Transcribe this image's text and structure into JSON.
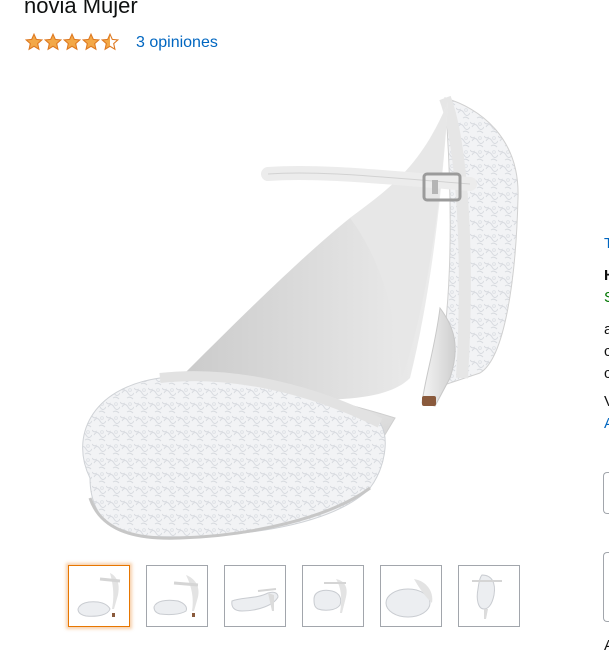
{
  "product": {
    "title": "novia Mujer",
    "rating": 4.5,
    "rating_max": 5,
    "reviews_text": "3 opiniones",
    "star_color": "#f3a847",
    "star_empty_color": "#ffffff",
    "star_stroke": "#de7921"
  },
  "gallery": {
    "selected_index": 0,
    "thumbnails": [
      "side-view",
      "side-view-alt",
      "angled-view",
      "front-view",
      "top-view",
      "back-view"
    ]
  },
  "right_column": {
    "line1": "T",
    "line2": "H",
    "line3": "S",
    "line4": "a",
    "line5": "c",
    "line6": "c",
    "line7": "V",
    "line8": "A",
    "line9": "A"
  }
}
